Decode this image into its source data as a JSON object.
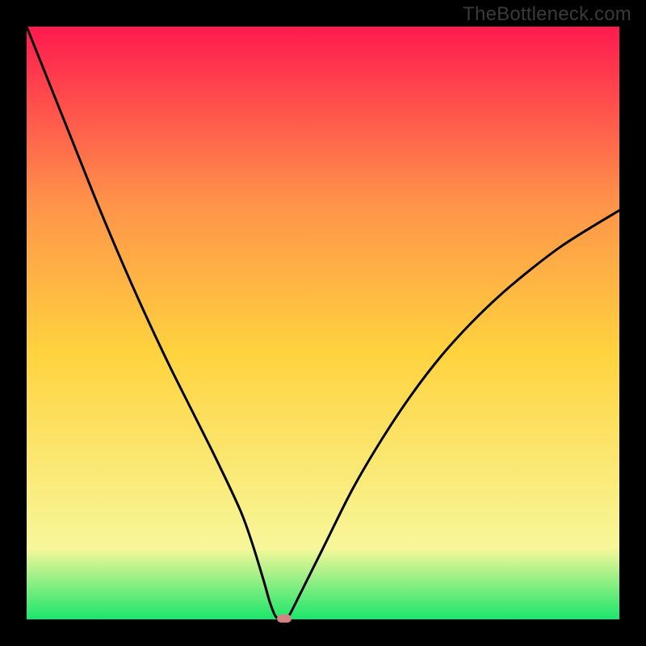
{
  "watermark": "TheBottleneck.com",
  "chart_data": {
    "type": "line",
    "title": "",
    "xlabel": "",
    "ylabel": "",
    "xlim": [
      0,
      100
    ],
    "ylim": [
      0,
      100
    ],
    "grid": false,
    "legend": false,
    "background_gradient": {
      "top_color": "#ff1a4e",
      "mid_upper_color": "#ff944a",
      "mid_color": "#ffd33e",
      "mid_lower_color": "#f7f79a",
      "bottom_color": "#1ae66b"
    },
    "series": [
      {
        "name": "bottleneck-curve",
        "x": [
          0,
          4,
          8,
          12,
          16,
          20,
          24,
          28,
          32,
          36,
          38,
          40,
          41,
          42,
          43,
          44,
          46,
          50,
          55,
          60,
          65,
          70,
          75,
          80,
          85,
          90,
          95,
          100
        ],
        "values": [
          100,
          90,
          80,
          70,
          60.5,
          51.5,
          43,
          35,
          27,
          18.5,
          13,
          6.5,
          3,
          0.5,
          0.2,
          0.2,
          4,
          12,
          22,
          30.5,
          38,
          44.5,
          50,
          54.8,
          59,
          62.8,
          66,
          69
        ]
      }
    ],
    "marker": {
      "name": "current-point",
      "x": 43.5,
      "y": 0.2,
      "color": "#d68282"
    }
  }
}
